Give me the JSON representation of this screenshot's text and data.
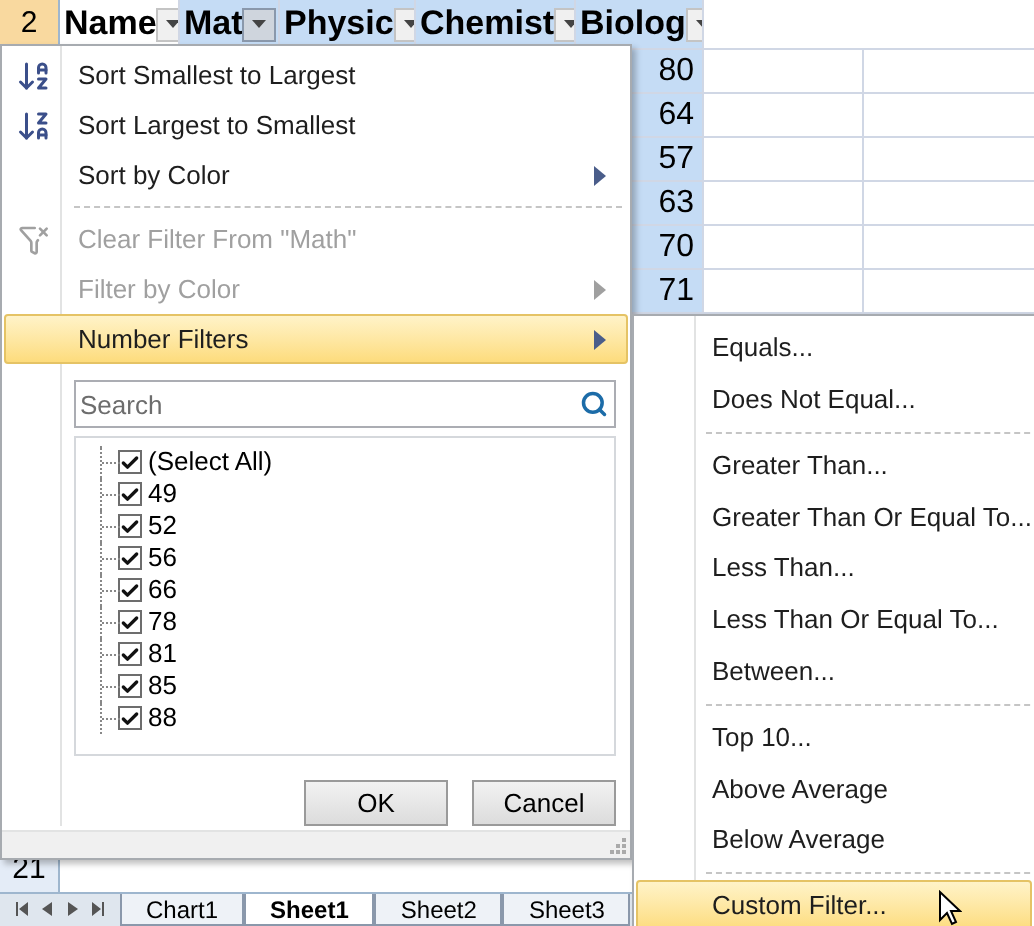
{
  "sheet": {
    "row_number": "2",
    "columns": [
      {
        "label": "Name",
        "selected": false,
        "filter_pressed": false
      },
      {
        "label": "Mat",
        "selected": true,
        "filter_pressed": true
      },
      {
        "label": "Physic",
        "selected": true,
        "filter_pressed": false
      },
      {
        "label": "Chemist",
        "selected": true,
        "filter_pressed": false
      },
      {
        "label": "Biolog",
        "selected": true,
        "filter_pressed": false
      }
    ],
    "values": [
      "80",
      "64",
      "57",
      "63",
      "70",
      "71"
    ],
    "last_row_number": "21",
    "tabs": [
      {
        "label": "Chart1",
        "selected": false
      },
      {
        "label": "Sheet1",
        "selected": true
      },
      {
        "label": "Sheet2",
        "selected": false
      },
      {
        "label": "Sheet3",
        "selected": false
      }
    ]
  },
  "menu": {
    "items": [
      {
        "kind": "item",
        "label": "Sort Smallest to Largest",
        "disabled": false,
        "selected": false,
        "submenu": false
      },
      {
        "kind": "item",
        "label": "Sort Largest to Smallest",
        "disabled": false,
        "selected": false,
        "submenu": false
      },
      {
        "kind": "item",
        "label": "Sort by Color",
        "disabled": false,
        "selected": false,
        "submenu": true
      },
      {
        "kind": "separator"
      },
      {
        "kind": "item",
        "label": "Clear Filter From \"Math\"",
        "disabled": true,
        "selected": false,
        "submenu": false
      },
      {
        "kind": "item",
        "label": "Filter by Color",
        "disabled": true,
        "selected": false,
        "submenu": true
      },
      {
        "kind": "item",
        "label": "Number Filters",
        "disabled": false,
        "selected": true,
        "submenu": true
      }
    ],
    "search": {
      "placeholder": "Search"
    },
    "list": [
      {
        "label": "(Select All)",
        "checked": true
      },
      {
        "label": "49",
        "checked": true
      },
      {
        "label": "52",
        "checked": true
      },
      {
        "label": "56",
        "checked": true
      },
      {
        "label": "66",
        "checked": true
      },
      {
        "label": "78",
        "checked": true
      },
      {
        "label": "81",
        "checked": true
      },
      {
        "label": "85",
        "checked": true
      },
      {
        "label": "88",
        "checked": true
      }
    ],
    "buttons": [
      "OK",
      "Cancel"
    ]
  },
  "submenu": {
    "items": [
      {
        "kind": "item",
        "label": "Equals...",
        "selected": false
      },
      {
        "kind": "item",
        "label": "Does Not Equal...",
        "selected": false
      },
      {
        "kind": "separator"
      },
      {
        "kind": "item",
        "label": "Greater Than...",
        "selected": false
      },
      {
        "kind": "item",
        "label": "Greater Than Or Equal To...",
        "selected": false
      },
      {
        "kind": "item",
        "label": "Less Than...",
        "selected": false
      },
      {
        "kind": "item",
        "label": "Less Than Or Equal To...",
        "selected": false
      },
      {
        "kind": "item",
        "label": "Between...",
        "selected": false
      },
      {
        "kind": "separator"
      },
      {
        "kind": "item",
        "label": "Top 10...",
        "selected": false
      },
      {
        "kind": "item",
        "label": "Above Average",
        "selected": false
      },
      {
        "kind": "item",
        "label": "Below Average",
        "selected": false
      },
      {
        "kind": "separator"
      },
      {
        "kind": "item",
        "label": "Custom Filter...",
        "selected": true
      }
    ]
  }
}
